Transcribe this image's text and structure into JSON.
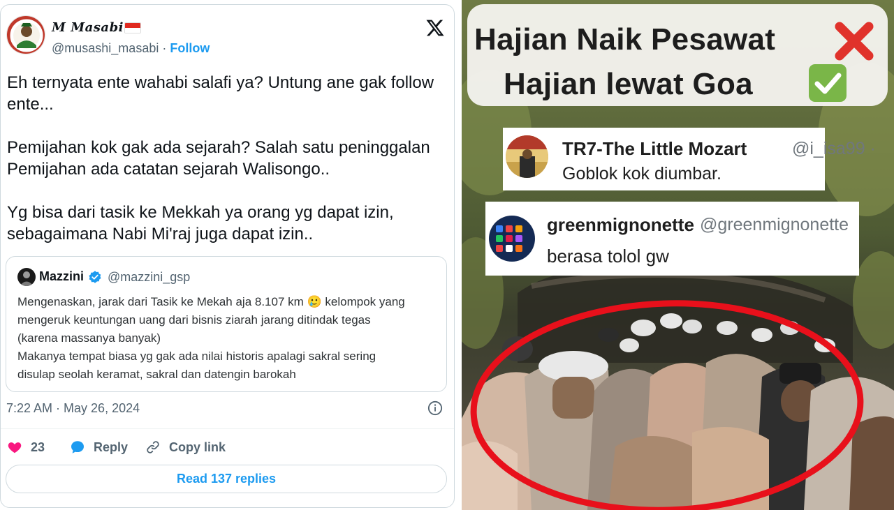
{
  "tweet": {
    "display_name": "M Masabi",
    "handle": "@musashi_masabi",
    "separator": " · ",
    "follow_label": "Follow",
    "flag_icon": "indonesia-flag-icon",
    "paragraphs": [
      "Eh ternyata ente wahabi salafi ya? Untung ane gak follow ente...",
      "Pemijahan kok gak ada sejarah? Salah satu peninggalan Pemijahan ada catatan sejarah Walisongo..",
      "Yg bisa dari tasik ke Mekkah ya orang yg dapat izin, sebagaimana Nabi Mi'raj juga dapat izin.."
    ],
    "quote": {
      "name": "Mazzini",
      "handle": "@mazzini_gsp",
      "text_lines": [
        "Mengenaskan, jarak dari Tasik ke Mekah aja 8.107 km 🥲 kelompok yang",
        "mengeruk keuntungan uang dari bisnis ziarah jarang ditindak tegas",
        "(karena massanya banyak)",
        "Makanya tempat biasa yg gak ada nilai historis apalagi sakral sering",
        "disulap seolah keramat, sakral dan datengin barokah"
      ]
    },
    "timestamp": "7:22 AM · May 26, 2024",
    "like_count": "23",
    "reply_label": "Reply",
    "copy_link_label": "Copy link",
    "read_replies_label": "Read 137 replies",
    "colors": {
      "accent": "#1d9bf0",
      "like": "#f91880",
      "muted": "#536471"
    }
  },
  "video": {
    "caption_line1": "Hajian Naik Pesawat",
    "caption_line2": "Hajian lewat Goa",
    "caption_icons": [
      "cross-mark-icon",
      "check-mark-icon"
    ],
    "replies": [
      {
        "name": "TR7-The Little Mozart",
        "handle": "@i_isa99 ·",
        "text": "Goblok kok diumbar."
      },
      {
        "name": "greenmignonette",
        "handle": "@greenmignonette",
        "text": "berasa tolol gw"
      }
    ],
    "highlight_color": "#e8101b"
  }
}
